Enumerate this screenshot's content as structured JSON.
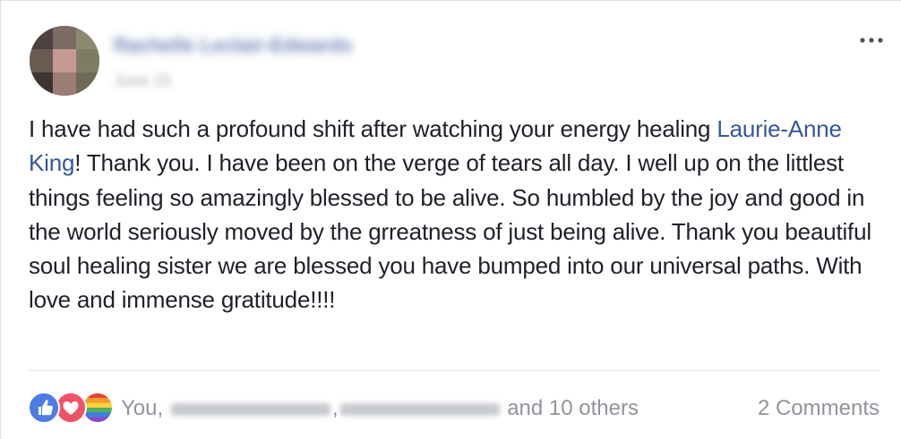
{
  "post": {
    "author_name": "Rachelle Leclair-Edwards",
    "date": "June 15",
    "text_before_mention": "I have had such a profound shift after watching your energy healing ",
    "mention": "Laurie-Anne King",
    "text_after_mention": "! Thank you. I have been on the verge of tears all day. I well up on the littlest things feeling so amazingly blessed to be alive. So humbled by the joy and good in the world seriously moved by the grreatness of just being alive. Thank you beautiful soul healing sister we are blessed you have bumped into our universal paths. With love and immense gratitude!!!!",
    "more_icon": "ellipsis-icon"
  },
  "footer": {
    "reaction_icons": [
      "like-icon",
      "love-icon",
      "pride-icon"
    ],
    "reactors_prefix": "You,",
    "reactors_separator": ",",
    "reactors_suffix": "and 10 others",
    "comments": "2 Comments"
  },
  "colors": {
    "link": "#365899",
    "text": "#1d2129",
    "meta": "#90949c",
    "like": "#4c7ce6",
    "love": "#f25268"
  }
}
